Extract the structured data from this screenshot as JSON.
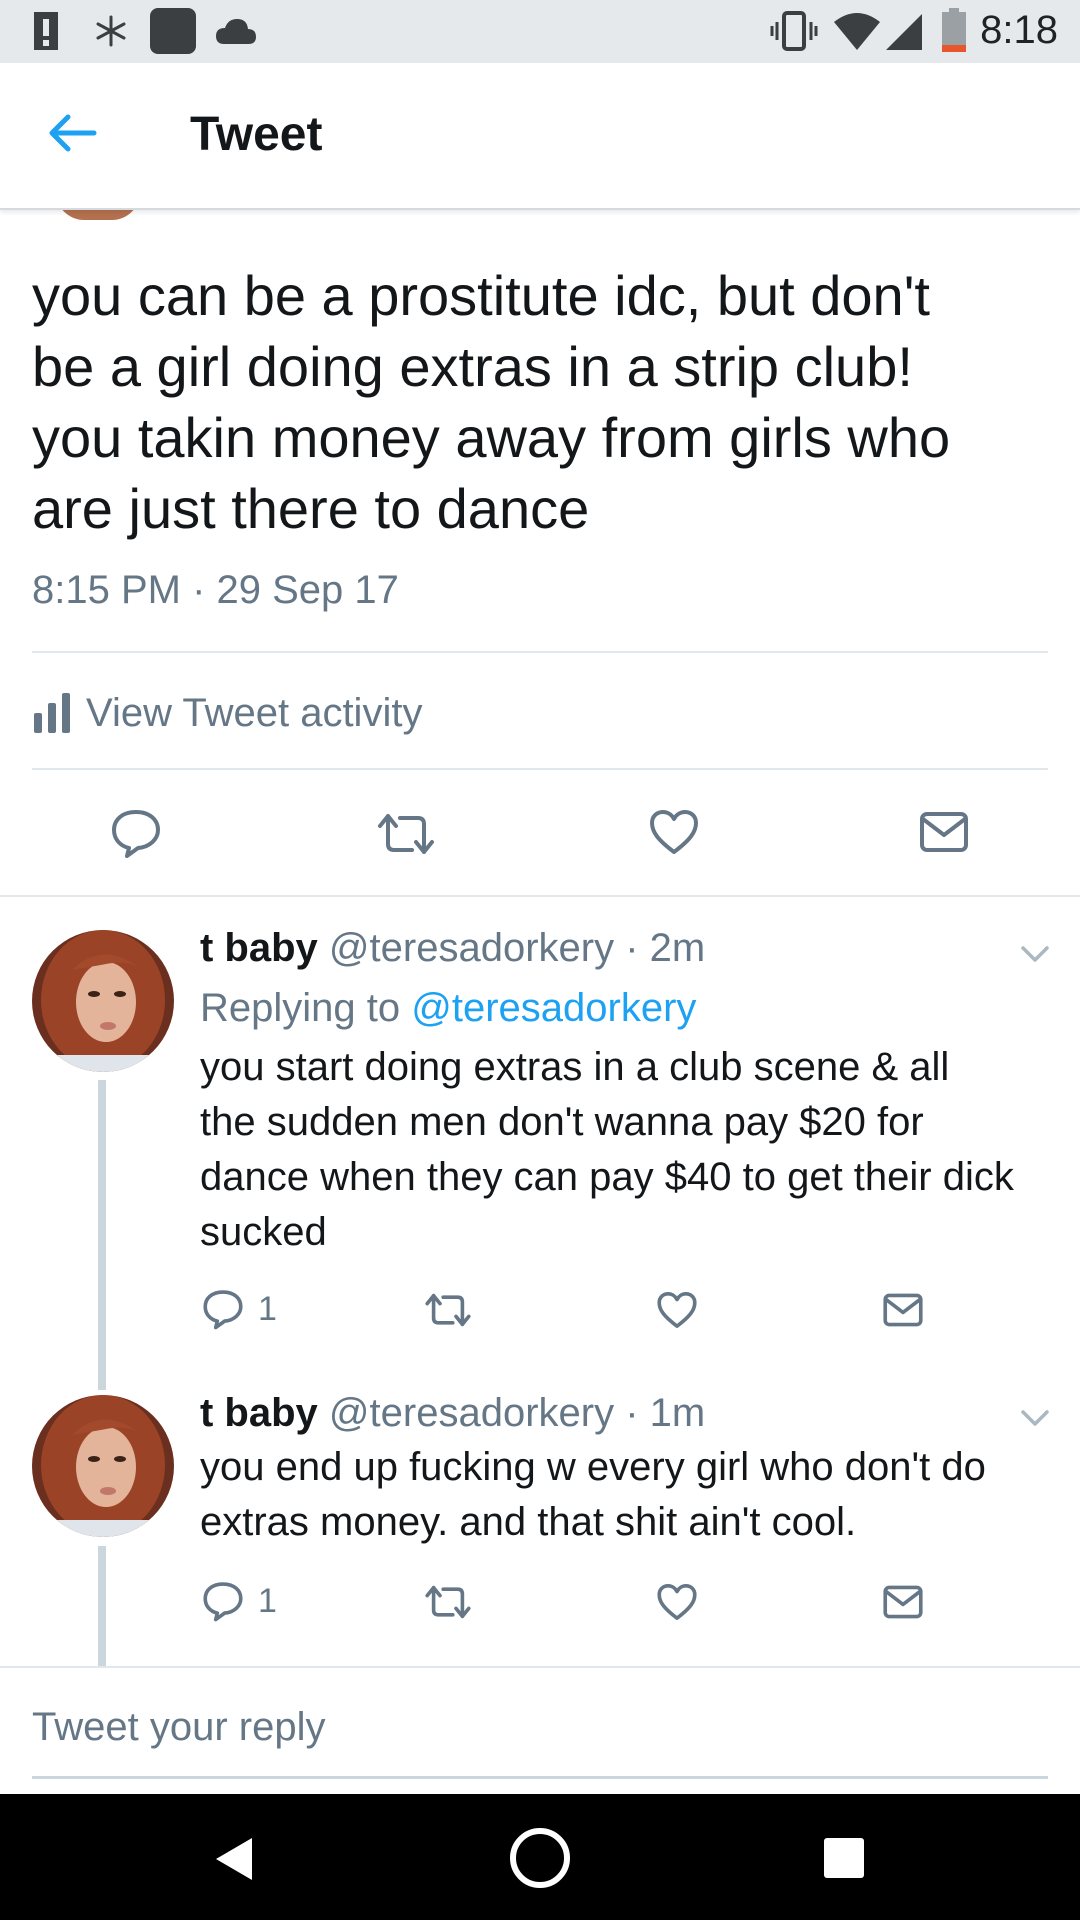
{
  "status_bar": {
    "time": "8:18",
    "icons": [
      "alert-icon",
      "asterisk-icon",
      "square-app-icon",
      "cloud-icon",
      "vibrate-icon",
      "wifi-icon",
      "signal-icon",
      "battery-icon"
    ]
  },
  "header": {
    "title": "Tweet",
    "back_icon": "back-arrow-icon"
  },
  "tweet": {
    "lines": [
      "you can be a prostitute idc, but don't",
      "be a girl doing extras in a strip club!",
      "you takin money away from girls who",
      "are just there to dance"
    ],
    "timestamp": "8:15 PM · 29 Sep 17",
    "activity_label": "View Tweet activity",
    "actions": [
      "reply-icon",
      "retweet-icon",
      "like-icon",
      "message-icon"
    ]
  },
  "replies": [
    {
      "name": "t baby",
      "handle": "@teresadorkery",
      "time": "· 2m",
      "replying_prefix": "Replying to",
      "replying_to": "@teresadorkery",
      "lines": [
        "you start doing extras in a club scene & all",
        "the sudden men don't wanna pay $20 for",
        "dance when they can pay $40 to get their dick",
        "sucked"
      ],
      "reply_count": "1"
    },
    {
      "name": "t baby",
      "handle": "@teresadorkery",
      "time": "· 1m",
      "lines": [
        "you end up fucking w every girl who don't do",
        "extras money. and that shit ain't cool."
      ],
      "reply_count": "1"
    }
  ],
  "composer": {
    "placeholder": "Tweet your reply"
  },
  "colors": {
    "accent": "#1da1f2",
    "secondary_text": "#657786",
    "primary_text": "#14171a",
    "status_bar": "#e6e9ec",
    "nav_bar": "#000000"
  }
}
